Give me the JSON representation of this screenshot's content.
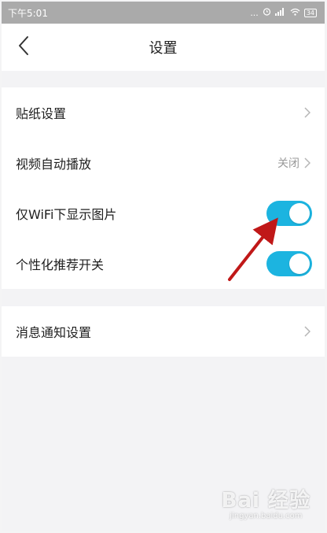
{
  "status_bar": {
    "time": "下午5:01",
    "icons": [
      "dots-icon",
      "alarm-icon",
      "signal-icon",
      "wifi-icon",
      "battery-icon"
    ],
    "dots": "...",
    "battery": "34"
  },
  "header": {
    "title": "设置",
    "back_icon": "chevron-left-icon"
  },
  "settings": {
    "sticker": {
      "label": "贴纸设置"
    },
    "video_autoplay": {
      "label": "视频自动播放",
      "value": "关闭"
    },
    "wifi_images": {
      "label": "仅WiFi下显示图片",
      "enabled": true
    },
    "personalized": {
      "label": "个性化推荐开关",
      "enabled": true
    },
    "notifications": {
      "label": "消息通知设置"
    }
  },
  "colors": {
    "toggle_on": "#1cb4e0",
    "arrow": "#c01818",
    "status_bar": "#aaaaaa",
    "background": "#f3f3f5"
  },
  "watermark": {
    "logo": "Bai 经验",
    "sub": "jingyan.baidu.com"
  }
}
